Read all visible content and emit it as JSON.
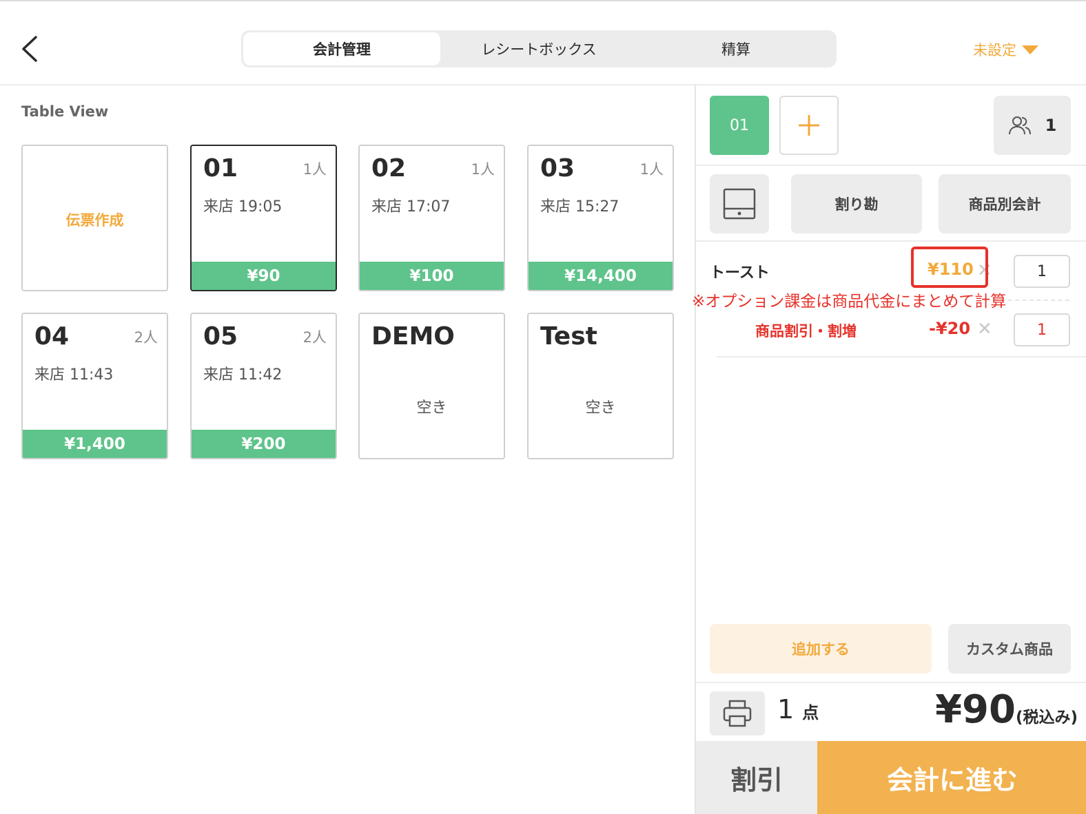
{
  "header": {
    "tabs": [
      {
        "label": "会計管理",
        "active": true
      },
      {
        "label": "レシートボックス",
        "active": false
      },
      {
        "label": "精算",
        "active": false
      }
    ],
    "status_label": "未設定"
  },
  "left": {
    "section_title": "Table View",
    "create_label": "伝票作成",
    "tables": [
      {
        "num": "01",
        "people": "1人",
        "time": "来店 19:05",
        "total": "¥90"
      },
      {
        "num": "02",
        "people": "1人",
        "time": "来店 17:07",
        "total": "¥100"
      },
      {
        "num": "03",
        "people": "1人",
        "time": "来店 15:27",
        "total": "¥14,400"
      },
      {
        "num": "04",
        "people": "2人",
        "time": "来店 11:43",
        "total": "¥1,400"
      },
      {
        "num": "05",
        "people": "2人",
        "time": "来店 11:42",
        "total": "¥200"
      },
      {
        "num": "DEMO",
        "status": "空き"
      },
      {
        "num": "Test",
        "status": "空き"
      }
    ]
  },
  "right": {
    "bill_tab": "01",
    "guest_count": "1",
    "split_label": "割り勘",
    "per_item_label": "商品別会計",
    "items": [
      {
        "name": "トースト",
        "price": "¥110",
        "qty": "1"
      },
      {
        "name": "商品割引・割増",
        "price": "-¥20",
        "qty": "1"
      }
    ],
    "note": "※オプション課金は商品代金にまとめて計算",
    "add_label": "追加する",
    "custom_label": "カスタム商品",
    "count": "1",
    "count_unit": "点",
    "total": "¥90",
    "tax_label": "(税込み)",
    "discount_label": "割引",
    "checkout_label": "会計に進む"
  },
  "colors": {
    "accent": "#f2a93b",
    "green": "#5ec48b",
    "alert": "#e6322b"
  }
}
